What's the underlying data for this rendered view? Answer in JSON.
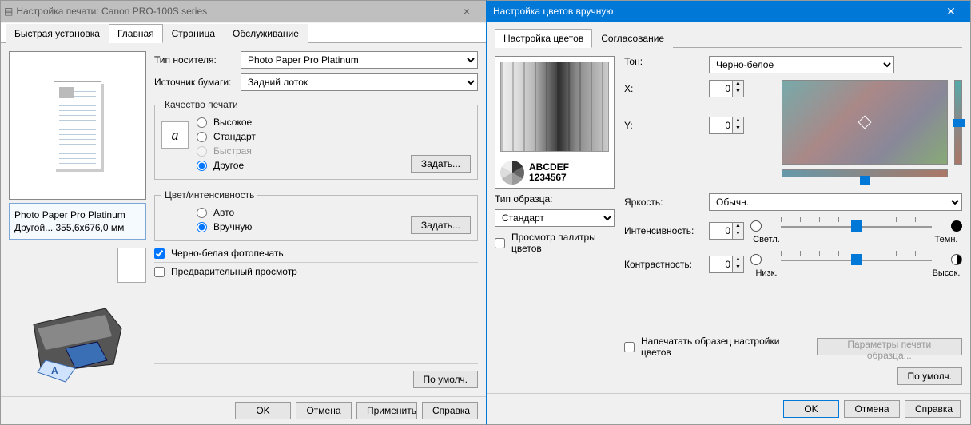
{
  "w1": {
    "title": "Настройка печати: Canon PRO-100S series",
    "tabs": [
      "Быстрая установка",
      "Главная",
      "Страница",
      "Обслуживание"
    ],
    "active_tab": 1,
    "media_label": "Тип носителя:",
    "media_value": "Photo Paper Pro Platinum",
    "source_label": "Источник бумаги:",
    "source_value": "Задний лоток",
    "quality_legend": "Качество печати",
    "quality_options": {
      "high": "Высокое",
      "standard": "Стандарт",
      "fast": "Быстрая",
      "other": "Другое"
    },
    "set_btn": "Задать...",
    "color_legend": "Цвет/интенсивность",
    "color_options": {
      "auto": "Авто",
      "manual": "Вручную"
    },
    "bw_label": "Черно-белая фотопечать",
    "preview_label": "Предварительный просмотр",
    "info_line1": "Photo Paper Pro Platinum",
    "info_line2": "Другой... 355,6x676,0 мм",
    "default_btn": "По умолч.",
    "ok": "OK",
    "cancel": "Отмена",
    "apply": "Применить",
    "help": "Справка"
  },
  "w2": {
    "title": "Настройка цветов вручную",
    "tabs": [
      "Настройка цветов",
      "Согласование"
    ],
    "active_tab": 0,
    "sample_type_label": "Тип образца:",
    "sample_type_value": "Стандарт",
    "palette_label": "Просмотр палитры цветов",
    "sample_abc": "ABCDEF",
    "sample_num": "1234567",
    "tone_label": "Тон:",
    "tone_value": "Черно-белое",
    "x_label": "X:",
    "x_value": "0",
    "y_label": "Y:",
    "y_value": "0",
    "brightness_label": "Яркость:",
    "brightness_value": "Обычн.",
    "intensity_label": "Интенсивность:",
    "intensity_value": "0",
    "intensity_left": "Светл.",
    "intensity_right": "Темн.",
    "contrast_label": "Контрастность:",
    "contrast_value": "0",
    "contrast_left": "Низк.",
    "contrast_right": "Высок.",
    "print_sample_label": "Напечатать образец настройки цветов",
    "sample_params_btn": "Параметры печати образца...",
    "default_btn": "По умолч.",
    "ok": "OK",
    "cancel": "Отмена",
    "help": "Справка"
  }
}
